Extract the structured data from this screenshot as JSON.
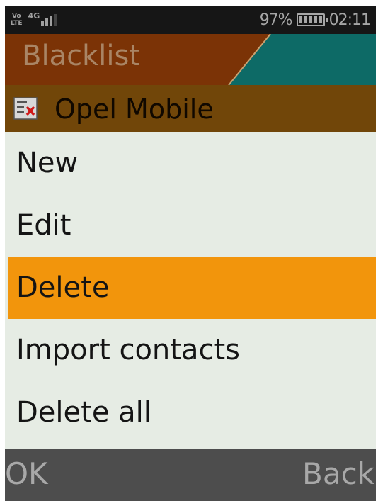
{
  "status_bar": {
    "volte_label": "Vo\nLTE",
    "network_type": "4G",
    "battery_percent": "97%",
    "battery_level": 1.0,
    "time": "02:11",
    "signal_icon": "signal-bars-icon",
    "battery_icon": "battery-icon"
  },
  "header": {
    "title": "Blacklist",
    "colors": {
      "left": "#7b3306",
      "right": "#0d6a66",
      "title_text": "#a98565"
    }
  },
  "context": {
    "icon": "blacklist-contact-icon",
    "title": "Opel Mobile",
    "background": "#714609"
  },
  "menu": {
    "items": [
      {
        "label": "New"
      },
      {
        "label": "Edit"
      },
      {
        "label": "Delete",
        "selected": true
      },
      {
        "label": "Import contacts"
      },
      {
        "label": "Delete all"
      }
    ],
    "selected_color": "#f2950c"
  },
  "softkeys": {
    "left": "OK",
    "right": "Back"
  }
}
